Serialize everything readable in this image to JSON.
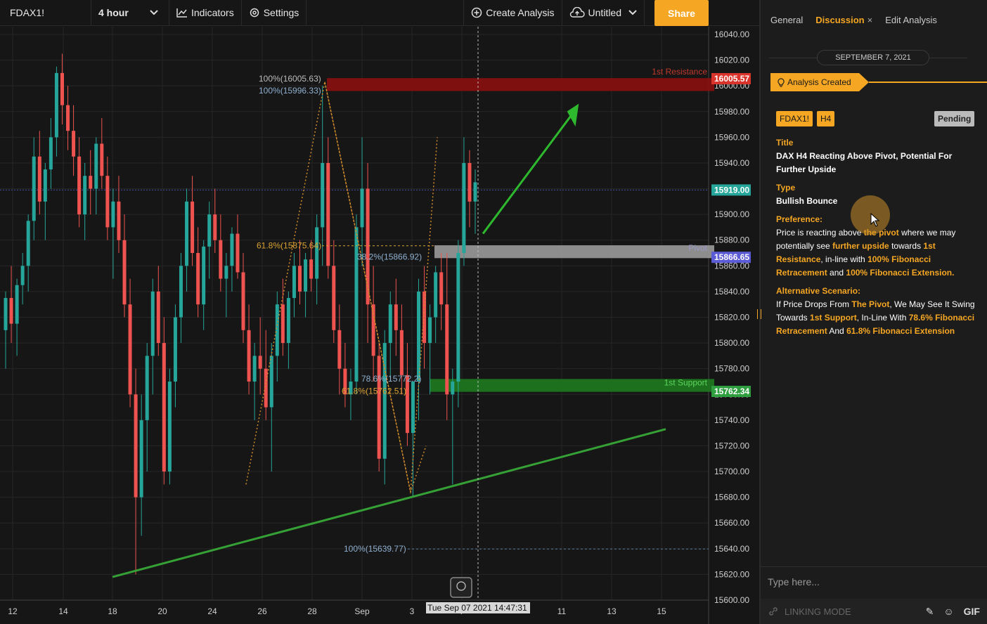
{
  "toolbar": {
    "symbol": "FDAX1!",
    "interval": "4 hour",
    "indicators_label": "Indicators",
    "settings_label": "Settings",
    "create_analysis_label": "Create Analysis",
    "layout_name": "Untitled",
    "share_label": "Share"
  },
  "chart_data": {
    "type": "candlestick",
    "symbol": "FDAX1!",
    "interval": "4 hour",
    "ylim": [
      15600,
      16040
    ],
    "y_ticks": [
      "16040.00",
      "16020.00",
      "16000.00",
      "15980.00",
      "15960.00",
      "15940.00",
      "15920.00",
      "15900.00",
      "15880.00",
      "15860.00",
      "15840.00",
      "15820.00",
      "15800.00",
      "15780.00",
      "15760.00",
      "15740.00",
      "15720.00",
      "15700.00",
      "15680.00",
      "15660.00",
      "15640.00",
      "15620.00",
      "15600.00"
    ],
    "x_ticks": [
      "12",
      "14",
      "18",
      "20",
      "24",
      "26",
      "28",
      "Sep",
      "3",
      "7",
      "11",
      "13",
      "15"
    ],
    "crosshair_time": "Tue Sep 07 2021 14:47:31",
    "price_labels": [
      {
        "value": "16005.57",
        "color": "#d9342b"
      },
      {
        "value": "15919.00",
        "color": "#26a69a"
      },
      {
        "value": "15866.65",
        "color": "#5b5bd6"
      },
      {
        "value": "15762.34",
        "color": "#2e9e3e"
      }
    ],
    "zones": [
      {
        "name": "1st Resistance",
        "from": 15996,
        "to": 16006,
        "color": "#8b1010"
      },
      {
        "name": "Pivot",
        "from": 15866,
        "to": 15876,
        "color": "#9a9a9a"
      },
      {
        "name": "1st Support",
        "from": 15762,
        "to": 15772,
        "color": "#1e7a1e"
      }
    ],
    "fib_labels": [
      {
        "text": "100%(16005.63)",
        "price": 16005.63,
        "color": "#bbbbbb"
      },
      {
        "text": "100%(15996.33)",
        "price": 15996.33,
        "color": "#8fb0d0"
      },
      {
        "text": "61.8%(15875.64)",
        "price": 15875.64,
        "color": "#d9a233"
      },
      {
        "text": "38.2%(15866.92)",
        "price": 15866.92,
        "color": "#8fb0d0"
      },
      {
        "text": "78.6%(15772.2)",
        "price": 15772.2,
        "color": "#8fb0d0"
      },
      {
        "text": "61.8%(15762.51)",
        "price": 15762.51,
        "color": "#d9a233"
      },
      {
        "text": "100%(15639.77)",
        "price": 15639.77,
        "color": "#8fb0d0"
      }
    ],
    "trendline": {
      "from": [
        18,
        15618
      ],
      "to": [
        15,
        15733
      ],
      "color": "#35a035"
    },
    "projection_arrow": {
      "from": [
        7,
        15885
      ],
      "to": [
        11,
        15983
      ],
      "color": "#2eb82e"
    },
    "candles": [
      [
        15810,
        15840,
        15780,
        15835
      ],
      [
        15835,
        15860,
        15800,
        15815
      ],
      [
        15815,
        15850,
        15790,
        15845
      ],
      [
        15845,
        15870,
        15830,
        15860
      ],
      [
        15860,
        15900,
        15840,
        15895
      ],
      [
        15895,
        15960,
        15880,
        15945
      ],
      [
        15945,
        15965,
        15900,
        15910
      ],
      [
        15910,
        15940,
        15880,
        15935
      ],
      [
        15935,
        15975,
        15920,
        15960
      ],
      [
        15960,
        16015,
        15945,
        16010
      ],
      [
        16010,
        16025,
        15970,
        15985
      ],
      [
        15985,
        16000,
        15950,
        15965
      ],
      [
        15965,
        15985,
        15930,
        15945
      ],
      [
        15945,
        15960,
        15890,
        15900
      ],
      [
        15900,
        15940,
        15880,
        15930
      ],
      [
        15930,
        15950,
        15900,
        15920
      ],
      [
        15920,
        15960,
        15900,
        15955
      ],
      [
        15955,
        15975,
        15920,
        15930
      ],
      [
        15930,
        15945,
        15880,
        15890
      ],
      [
        15890,
        15920,
        15850,
        15910
      ],
      [
        15910,
        15930,
        15870,
        15880
      ],
      [
        15880,
        15900,
        15820,
        15830
      ],
      [
        15830,
        15850,
        15750,
        15760
      ],
      [
        15760,
        15780,
        15620,
        15680
      ],
      [
        15680,
        15760,
        15650,
        15740
      ],
      [
        15740,
        15800,
        15700,
        15790
      ],
      [
        15790,
        15850,
        15760,
        15840
      ],
      [
        15840,
        15860,
        15790,
        15800
      ],
      [
        15800,
        15820,
        15690,
        15700
      ],
      [
        15700,
        15780,
        15690,
        15770
      ],
      [
        15770,
        15830,
        15750,
        15820
      ],
      [
        15820,
        15870,
        15800,
        15860
      ],
      [
        15860,
        15920,
        15840,
        15910
      ],
      [
        15910,
        15930,
        15860,
        15870
      ],
      [
        15870,
        15890,
        15820,
        15830
      ],
      [
        15830,
        15880,
        15810,
        15875
      ],
      [
        15875,
        15910,
        15850,
        15900
      ],
      [
        15900,
        15920,
        15870,
        15880
      ],
      [
        15880,
        15900,
        15840,
        15850
      ],
      [
        15850,
        15870,
        15820,
        15860
      ],
      [
        15860,
        15890,
        15840,
        15885
      ],
      [
        15885,
        15900,
        15850,
        15855
      ],
      [
        15855,
        15870,
        15800,
        15810
      ],
      [
        15810,
        15830,
        15760,
        15770
      ],
      [
        15770,
        15800,
        15740,
        15790
      ],
      [
        15790,
        15820,
        15760,
        15780
      ],
      [
        15780,
        15810,
        15740,
        15750
      ],
      [
        15750,
        15800,
        15700,
        15790
      ],
      [
        15790,
        15840,
        15770,
        15830
      ],
      [
        15830,
        15850,
        15790,
        15800
      ],
      [
        15800,
        15840,
        15780,
        15835
      ],
      [
        15835,
        15870,
        15820,
        15860
      ],
      [
        15860,
        15880,
        15830,
        15840
      ],
      [
        15840,
        15870,
        15820,
        15865
      ],
      [
        15865,
        15880,
        15840,
        15850
      ],
      [
        15850,
        15900,
        15830,
        15890
      ],
      [
        15890,
        16000,
        15860,
        15940
      ],
      [
        15940,
        15960,
        15850,
        15860
      ],
      [
        15860,
        15880,
        15800,
        15810
      ],
      [
        15810,
        15830,
        15760,
        15780
      ],
      [
        15780,
        15800,
        15750,
        15760
      ],
      [
        15760,
        15780,
        15740,
        15770
      ],
      [
        15770,
        15900,
        15760,
        15890
      ],
      [
        15890,
        15960,
        15860,
        15920
      ],
      [
        15920,
        15940,
        15800,
        15830
      ],
      [
        15830,
        15860,
        15770,
        15790
      ],
      [
        15790,
        15800,
        15700,
        15710
      ],
      [
        15710,
        15810,
        15690,
        15800
      ],
      [
        15800,
        15840,
        15770,
        15830
      ],
      [
        15830,
        15850,
        15790,
        15810
      ],
      [
        15810,
        15830,
        15760,
        15775
      ],
      [
        15775,
        15800,
        15720,
        15730
      ],
      [
        15730,
        15760,
        15680,
        15770
      ],
      [
        15770,
        15850,
        15740,
        15840
      ],
      [
        15840,
        15860,
        15780,
        15800
      ],
      [
        15800,
        15830,
        15760,
        15820
      ],
      [
        15820,
        15860,
        15800,
        15855
      ],
      [
        15855,
        15870,
        15810,
        15830
      ],
      [
        15830,
        15870,
        15740,
        15760
      ],
      [
        15760,
        15780,
        15690,
        15770
      ],
      [
        15770,
        15880,
        15750,
        15870
      ],
      [
        15870,
        15960,
        15860,
        15940
      ],
      [
        15940,
        15950,
        15890,
        15910
      ],
      [
        15910,
        15935,
        15885,
        15925
      ]
    ]
  },
  "panel": {
    "tabs": [
      {
        "label": "General"
      },
      {
        "label": "Discussion",
        "close": "×"
      },
      {
        "label": "Edit Analysis"
      }
    ],
    "date": "SEPTEMBER 7, 2021",
    "created_label": "Analysis Created",
    "badge_symbol": "FDAX1!",
    "badge_tf": "H4",
    "badge_status": "Pending",
    "title_label": "Title",
    "title_value": "DAX H4 Reacting Above Pivot, Potential For Further Upside",
    "type_label": "Type",
    "type_value": "Bullish Bounce",
    "preference_label": "Preference:",
    "pref_1": "Price is reacting above ",
    "pref_2": "the pivot",
    "pref_3": " where we may potentially see ",
    "pref_4": "further upside",
    "pref_5": " towards ",
    "pref_6": "1st Resistance",
    "pref_7": ", in-line with ",
    "pref_8": "100% Fibonacci Retracement",
    "pref_9": " and ",
    "pref_10": "100% Fibonacci Extension.",
    "alt_label": "Alternative Scenario:",
    "alt_1": "If Price Drops From ",
    "alt_2": "The Pivot",
    "alt_3": ", We May See It Swing Towards ",
    "alt_4": "1st Support",
    "alt_5": ", In-Line With ",
    "alt_6": "78.6% Fibonacci Retracement",
    "alt_7": " And ",
    "alt_8": "61.8% Fibonacci Extension",
    "input_placeholder": "Type here...",
    "linking_mode": "LINKING MODE",
    "gif_label": "GIF"
  }
}
